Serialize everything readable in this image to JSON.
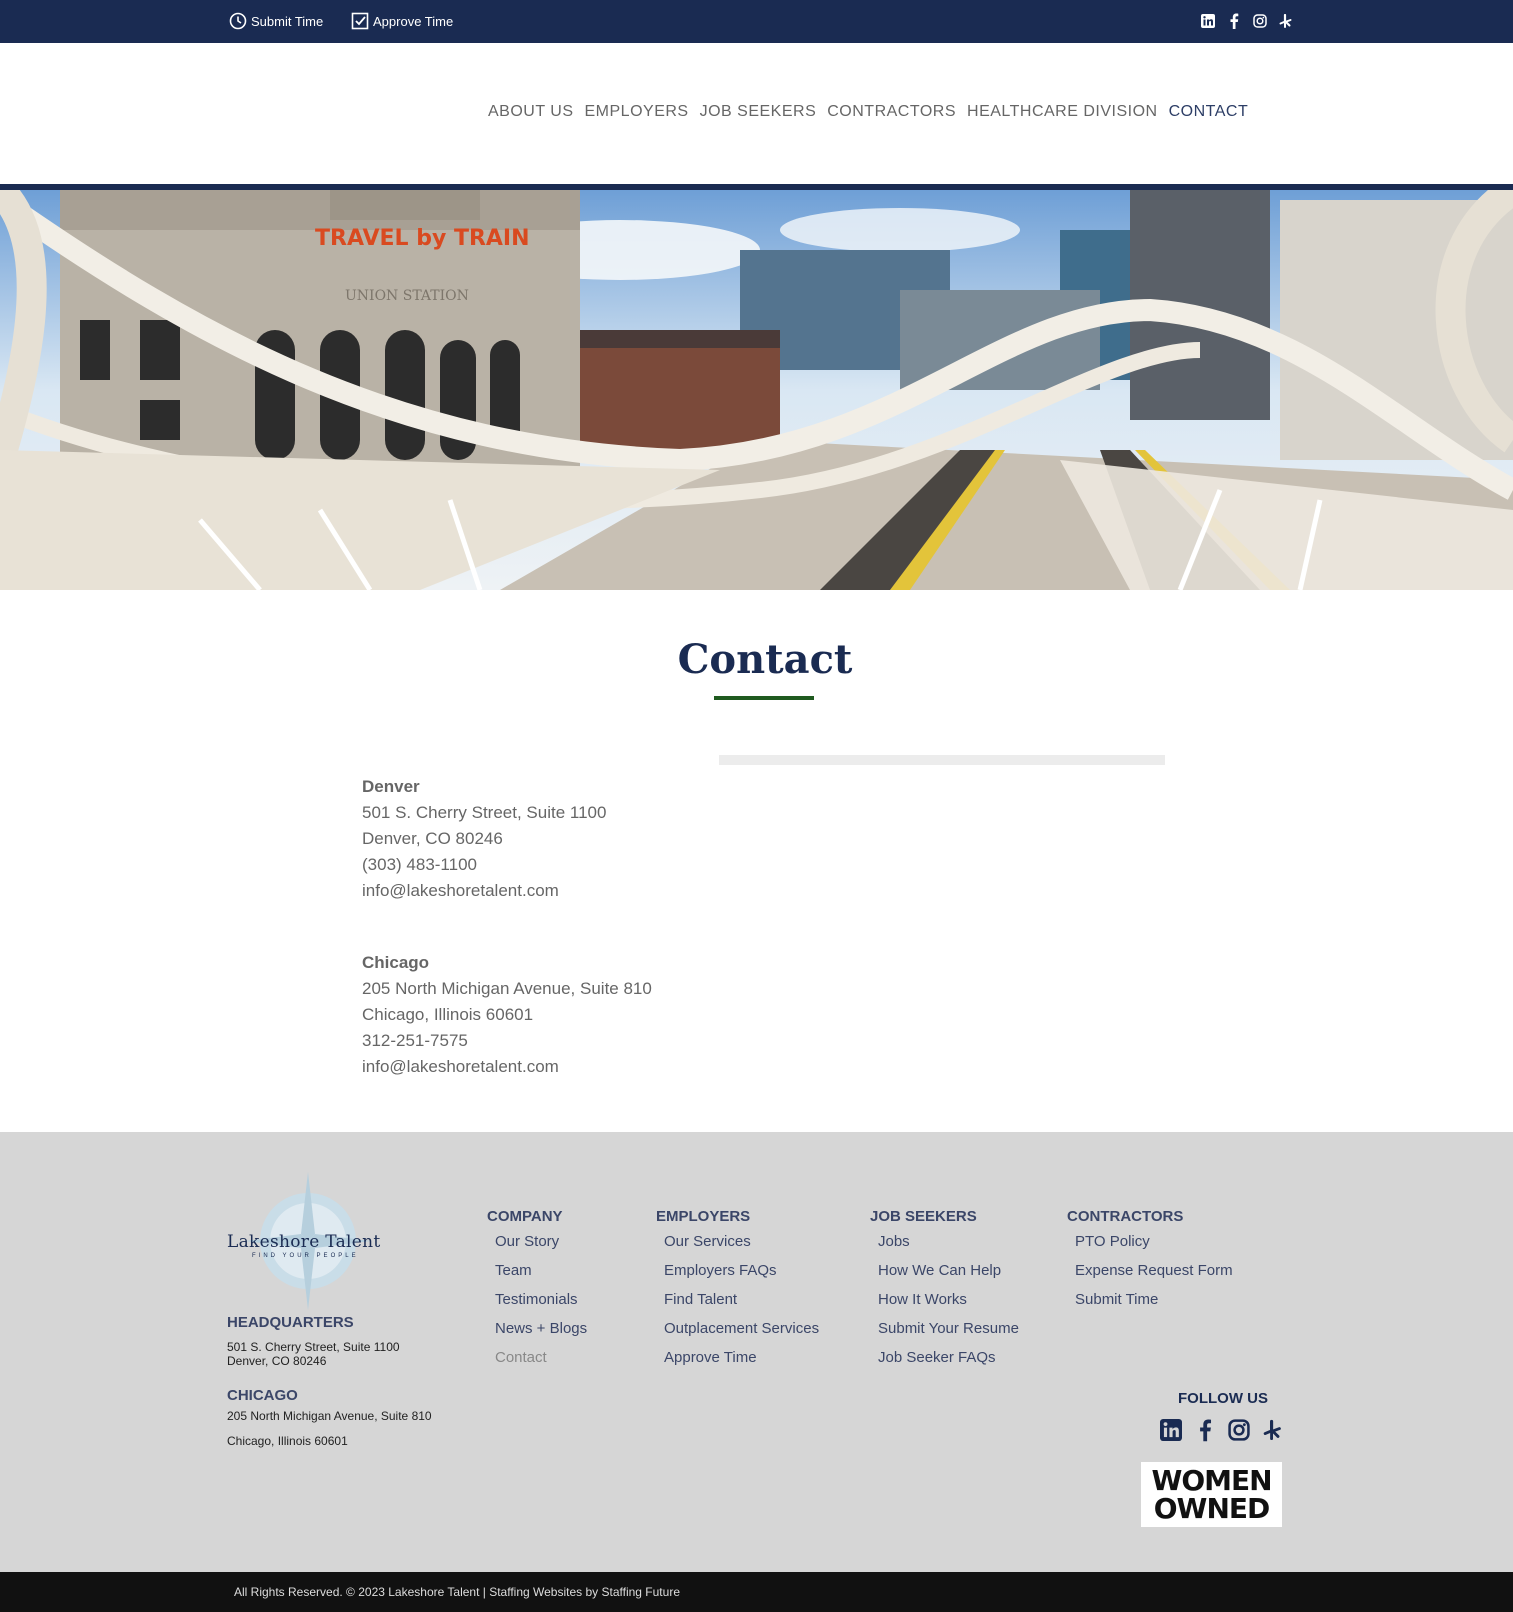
{
  "topbar": {
    "submit_time": "Submit Time",
    "approve_time": "Approve Time"
  },
  "nav": {
    "items": [
      "ABOUT US",
      "EMPLOYERS",
      "JOB SEEKERS",
      "CONTRACTORS",
      "HEALTHCARE DIVISION",
      "CONTACT"
    ],
    "active": "CONTACT"
  },
  "hero": {
    "sign_text": "TRAVEL by TRAIN",
    "building_text": "UNION STATION"
  },
  "contact": {
    "title": "Contact",
    "offices": [
      {
        "name": "Denver",
        "address1": "501 S. Cherry Street, Suite 1100",
        "address2": "Denver, CO 80246",
        "phone": "(303) 483-1100",
        "email": "info@lakeshoretalent.com"
      },
      {
        "name": "Chicago",
        "address1": "205 North Michigan Avenue, Suite 810",
        "address2": "Chicago, Illinois 60601",
        "phone": "312-251-7575",
        "email": "info@lakeshoretalent.com"
      }
    ]
  },
  "footer": {
    "logo_text": "Lakeshore Talent",
    "logo_sub": "FIND YOUR PEOPLE",
    "hq_heading": "HEADQUARTERS",
    "hq_line1": "501 S. Cherry Street, Suite 1100",
    "hq_line2": "Denver, CO 80246",
    "chicago_heading": "CHICAGO",
    "chicago_line1": "205 North Michigan Avenue, Suite 810",
    "chicago_line2": "Chicago, Illinois 60601",
    "columns": [
      {
        "heading": "COMPANY",
        "items": [
          "Our Story",
          "Team",
          "Testimonials",
          "News + Blogs",
          "Contact"
        ]
      },
      {
        "heading": "EMPLOYERS",
        "items": [
          "Our Services",
          "Employers FAQs",
          "Find Talent",
          "Outplacement Services",
          "Approve Time"
        ]
      },
      {
        "heading": "JOB SEEKERS",
        "items": [
          "Jobs",
          "How We Can Help",
          "How It Works",
          "Submit Your Resume",
          "Job Seeker FAQs"
        ]
      },
      {
        "heading": "CONTRACTORS",
        "items": [
          "PTO Policy",
          "Expense Request Form",
          "Submit Time"
        ]
      }
    ],
    "follow_us": "FOLLOW US",
    "badge_line1": "WOMEN",
    "badge_line2": "OWNED",
    "social_icons": [
      "linkedin-icon",
      "facebook-icon",
      "instagram-icon",
      "yelp-icon"
    ]
  },
  "copyright": "All Rights Reserved. © 2023 Lakeshore Talent  |  Staffing Websites by Staffing Future",
  "colors": {
    "navy": "#1a2b52",
    "accent_green": "#1f5a1f",
    "footer_bg": "#d6d6d6"
  }
}
